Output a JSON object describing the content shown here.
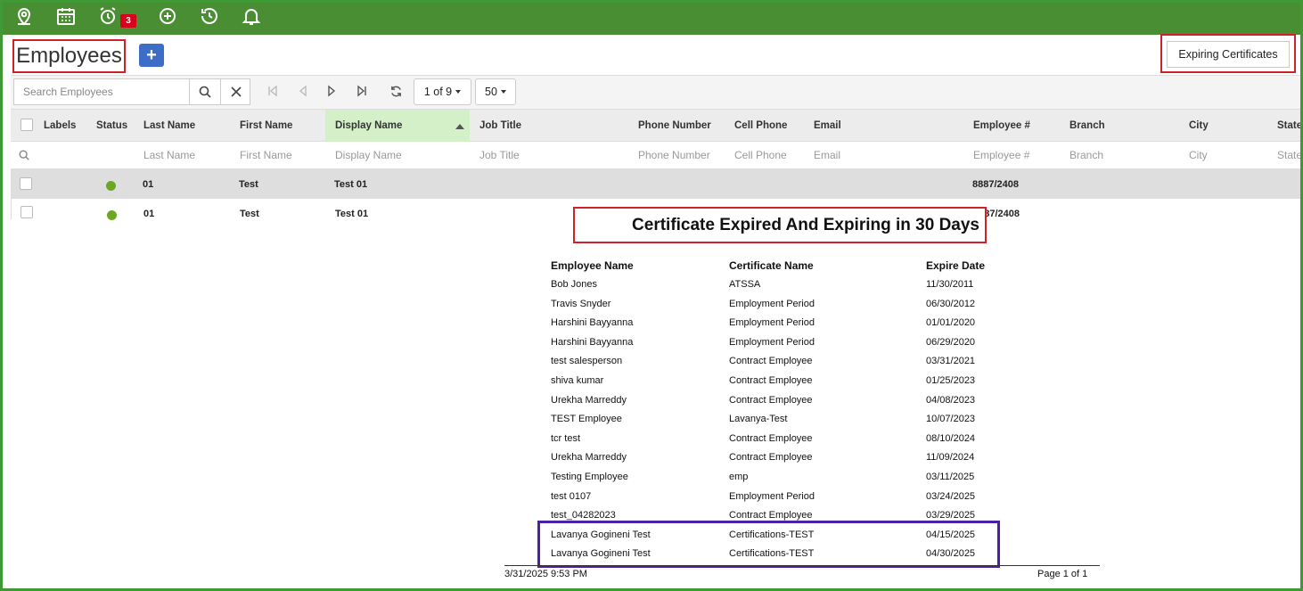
{
  "toolbar_icons": [
    "location-pin-icon",
    "calendar-icon",
    "alarm-clock-icon",
    "plus-circle-icon",
    "history-icon",
    "bell-icon"
  ],
  "alarm_badge": "3",
  "header": {
    "title": "Employees",
    "add_label": "+",
    "expiring_button": "Expiring Certificates"
  },
  "grid_toolbar": {
    "search_placeholder": "Search Employees",
    "page_label": "1 of 9",
    "page_size": "50"
  },
  "columns": [
    "Labels",
    "Status",
    "Last Name",
    "First Name",
    "Display Name",
    "Job Title",
    "Phone Number",
    "Cell Phone",
    "Email",
    "Employee #",
    "Branch",
    "City",
    "State"
  ],
  "filters": [
    "Last Name",
    "First Name",
    "Display Name",
    "Job Title",
    "Phone Number",
    "Cell Phone",
    "Email",
    "Employee #",
    "Branch",
    "City",
    "State"
  ],
  "rows": [
    {
      "last": "01",
      "first": "Test",
      "display": "Test 01",
      "emp": "8887/2408"
    },
    {
      "last": "01",
      "first": "Test",
      "display": "Test 01",
      "emp": "8887/2408"
    }
  ],
  "status_color": "#6aa820",
  "report": {
    "title": "Certificate Expired And Expiring in 30 Days",
    "headers": [
      "Employee Name",
      "Certificate Name",
      "Expire Date"
    ],
    "rows": [
      [
        "Bob Jones",
        "ATSSA",
        "11/30/2011"
      ],
      [
        "Travis Snyder",
        "Employment Period",
        "06/30/2012"
      ],
      [
        "Harshini Bayyanna",
        "Employment Period",
        "01/01/2020"
      ],
      [
        "Harshini Bayyanna",
        "Employment Period",
        "06/29/2020"
      ],
      [
        "test salesperson",
        "Contract Employee",
        "03/31/2021"
      ],
      [
        "shiva kumar",
        "Contract Employee",
        "01/25/2023"
      ],
      [
        "Urekha Marreddy",
        "Contract Employee",
        "04/08/2023"
      ],
      [
        "TEST Employee",
        "Lavanya-Test",
        "10/07/2023"
      ],
      [
        "tcr test",
        "Contract Employee",
        "08/10/2024"
      ],
      [
        "Urekha Marreddy",
        "Contract Employee",
        "11/09/2024"
      ],
      [
        "Testing Employee",
        "emp",
        "03/11/2025"
      ],
      [
        "test 0107",
        "Employment Period",
        "03/24/2025"
      ],
      [
        "test_04282023",
        "Contract Employee",
        "03/29/2025"
      ],
      [
        "Lavanya Gogineni Test",
        "Certifications-TEST",
        "04/15/2025"
      ],
      [
        "Lavanya Gogineni Test",
        "Certifications-TEST",
        "04/30/2025"
      ]
    ],
    "footer_left": "3/31/2025 9:53 PM",
    "footer_right": "Page 1 of 1"
  }
}
